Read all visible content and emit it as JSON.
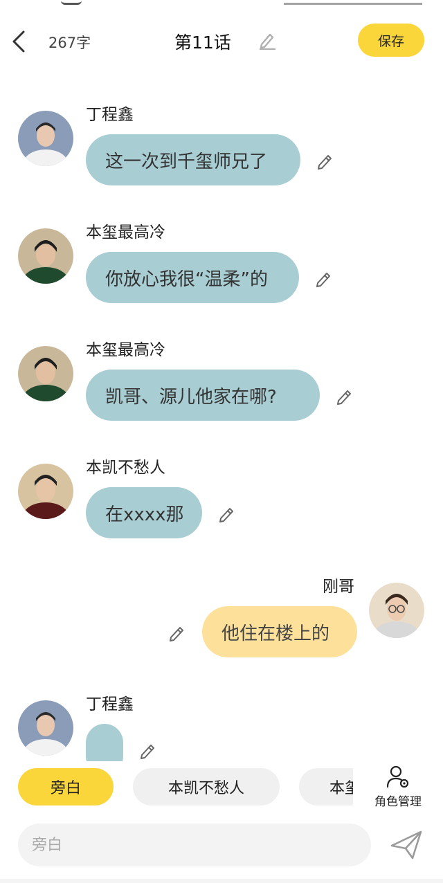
{
  "header": {
    "char_count": "267字",
    "title": "第11话",
    "save_label": "保存"
  },
  "messages": [
    {
      "side": "left",
      "name": "丁程鑫",
      "text": "这一次到千玺师兄了",
      "avatar": "avatar-dingchengxin"
    },
    {
      "side": "left",
      "name": "本玺最高冷",
      "text": "你放心我很“温柔”的",
      "avatar": "avatar-benxi"
    },
    {
      "side": "left",
      "name": "本玺最高冷",
      "text": "凯哥、源儿他家在哪?",
      "avatar": "avatar-benxi"
    },
    {
      "side": "left",
      "name": "本凯不愁人",
      "text": "在xxxx那",
      "avatar": "avatar-benkai"
    },
    {
      "side": "right",
      "name": "刚哥",
      "text": "他住在楼上的",
      "avatar": "avatar-gangge"
    },
    {
      "side": "left",
      "name": "丁程鑫",
      "text": "",
      "avatar": "avatar-dingchengxin"
    }
  ],
  "roles": {
    "chips": [
      "旁白",
      "本凯不愁人",
      "本玺最高冷"
    ],
    "active": "旁白",
    "manage_label": "角色管理"
  },
  "composer": {
    "placeholder": "旁白"
  },
  "colors": {
    "accent": "#fbd63a",
    "left_bubble": "#a8cdd3",
    "right_bubble": "#fde19a"
  }
}
